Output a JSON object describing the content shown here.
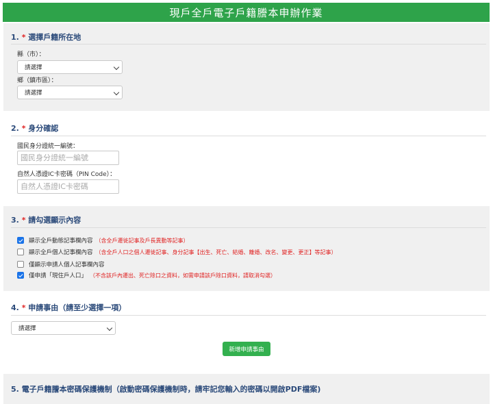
{
  "header": {
    "title": "現戶全戶電子戶籍謄本申辦作業"
  },
  "section1": {
    "number": "1.",
    "required_mark": "*",
    "title": "選擇戶籍所在地",
    "county_label": "縣（市）：",
    "county_value": "請選擇",
    "town_label": "鄉（鎮市區）：",
    "town_value": "請選擇"
  },
  "section2": {
    "number": "2.",
    "required_mark": "*",
    "title": "身分確認",
    "id_label": "國民身分證統一編號：",
    "id_placeholder": "國民身分證統一編號",
    "pin_label": "自然人憑證IC卡密碼（PIN Code）：",
    "pin_placeholder": "自然人憑證IC卡密碼"
  },
  "section3": {
    "number": "3.",
    "required_mark": "*",
    "title": "請勾選顯示內容",
    "options": [
      {
        "label": "顯示全戶動態記事欄內容",
        "note": "（含全戶遷徙記事及戶長異動等記事）",
        "checked": true
      },
      {
        "label": "顯示全戶個人記事欄內容",
        "note": "（含全戶人口之個人遷徙記事、身分記事【出生、死亡、結婚、離婚、改名、變更、更正】等記事）",
        "checked": false
      },
      {
        "label": "僅顯示申請人個人記事欄內容",
        "note": "",
        "checked": false
      },
      {
        "label": "僅申請「現住戶人口」",
        "note": "（不含該戶內遷出、死亡除口之資料，如需申請該戶除口資料，請取消勾選）",
        "checked": true
      }
    ]
  },
  "section4": {
    "number": "4.",
    "required_mark": "*",
    "title": "申請事由（請至少選擇一項）",
    "reason_value": "請選擇",
    "add_button": "新增申請事由"
  },
  "section5": {
    "number": "5.",
    "title": "電子戶籍謄本密碼保護機制（啟動密碼保護機制時，請牢記您輸入的密碼以開啟PDF檔案)"
  },
  "colors": {
    "header_bg": "#2ea34a",
    "title_text": "#2b4a7a",
    "required": "#e02424",
    "button_bg": "#33b04f"
  }
}
